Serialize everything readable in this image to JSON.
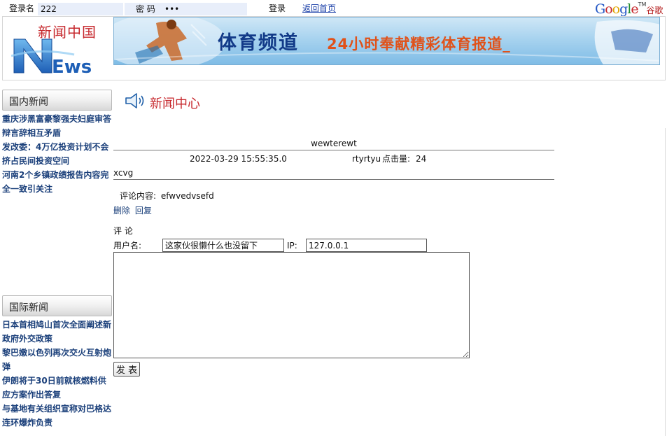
{
  "login_bar": {
    "username_label": "登录名",
    "username_value": "222",
    "password_label": "密  码",
    "password_value": "•••",
    "login_label": "登录",
    "home_link": "返回首页"
  },
  "google_logo": {
    "text": "Google",
    "tm": "TM",
    "cn": "谷歌"
  },
  "header": {
    "logo_cn": "新闻中国",
    "logo_en": "NEws",
    "banner_title": "体育频道",
    "banner_slogan": "24小时奉献精彩体育报道_"
  },
  "sidebar": {
    "domestic_title": "国内新闻",
    "domestic_items": [
      "重庆涉黑富豪黎强夫妇庭审答辩言辞相互矛盾",
      "发改委：4万亿投资计划不会挤占民间投资空间",
      "河南2个乡镇政绩报告内容完全一致引关注"
    ],
    "international_title": "国际新闻",
    "international_items": [
      "日本首相鸠山首次全面阐述新政府外交政策",
      "黎巴嫩以色列再次交火互射炮弹",
      "伊朗将于30日前就核燃料供应方案作出答复",
      "与基地有关组织宣称对巴格达连环爆炸负责"
    ]
  },
  "main": {
    "section_title": "新闻中心",
    "article": {
      "title": "wewterewt",
      "datetime": "2022-03-29 15:55:35.0",
      "author": "rtyrtyu",
      "clicks_label": "点击量:",
      "clicks": "24",
      "body": "xcvg"
    },
    "comment": {
      "label": "评论内容:",
      "value": "efwvedvsefd",
      "delete_label": "删除",
      "reply_label": "回复"
    },
    "form": {
      "title": "评 论",
      "username_label": "用户名:",
      "username_value": "这家伙很懒什么也没留下",
      "ip_label": "IP:",
      "ip_value": "127.0.0.1",
      "content_value": "",
      "submit_label": "发 表"
    }
  },
  "colors": {
    "link": "#1a3f7a",
    "accent_red": "#c6262b",
    "banner_blue": "#123a88",
    "banner_orange": "#e0521a"
  }
}
